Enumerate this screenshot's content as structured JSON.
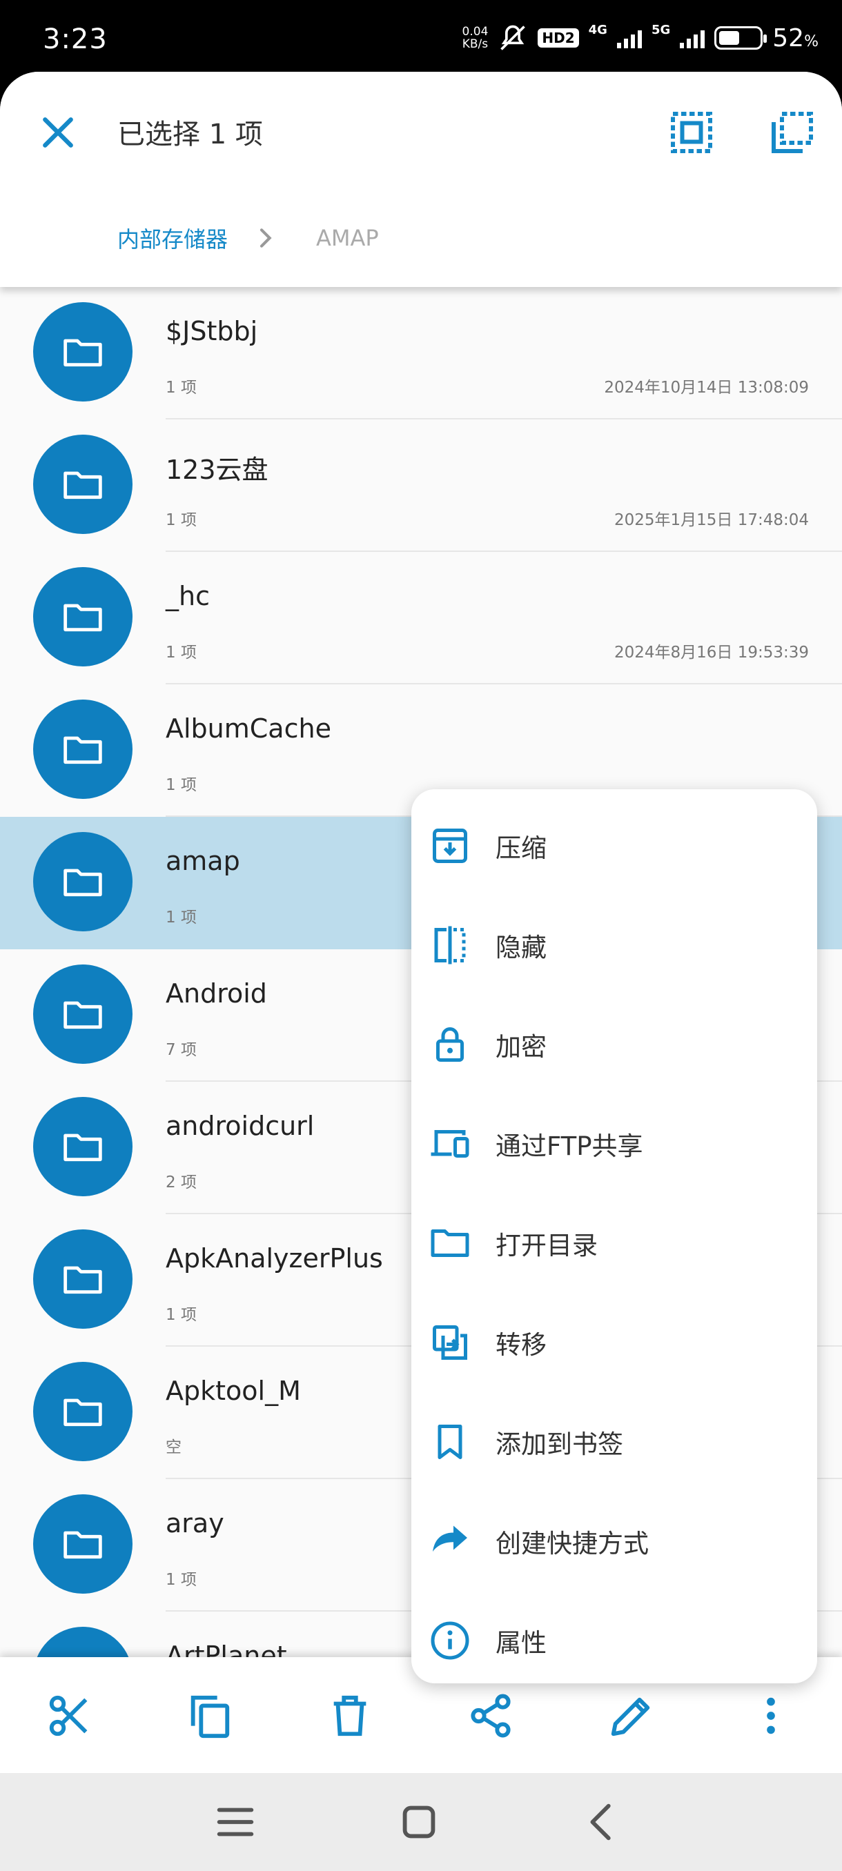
{
  "status_bar": {
    "time": "3:23",
    "speed_value": "0.04",
    "speed_unit": "KB/s",
    "hd_badge": "HD2",
    "network_1": "4G",
    "network_2": "5G",
    "battery_percent": "52",
    "battery_unit": "%",
    "battery_level": 0.52
  },
  "header": {
    "title": "已选择 1 项",
    "breadcrumb": [
      "内部存储器",
      "AMAP"
    ]
  },
  "files": [
    {
      "name": "$JStbbj",
      "count": "1 项",
      "date": "2024年10月14日 13:08:09",
      "selected": false
    },
    {
      "name": "123云盘",
      "count": "1 项",
      "date": "2025年1月15日 17:48:04",
      "selected": false
    },
    {
      "name": "_hc",
      "count": "1 项",
      "date": "2024年8月16日 19:53:39",
      "selected": false
    },
    {
      "name": "AlbumCache",
      "count": "1 项",
      "date": "",
      "selected": false
    },
    {
      "name": "amap",
      "count": "1 项",
      "date": "",
      "selected": true
    },
    {
      "name": "Android",
      "count": "7 项",
      "date": "",
      "selected": false
    },
    {
      "name": "androidcurl",
      "count": "2 项",
      "date": "",
      "selected": false
    },
    {
      "name": "ApkAnalyzerPlus",
      "count": "1 项",
      "date": "",
      "selected": false
    },
    {
      "name": "Apktool_M",
      "count": "空",
      "date": "",
      "selected": false
    },
    {
      "name": "aray",
      "count": "1 项",
      "date": "",
      "selected": false
    },
    {
      "name": "ArtPlanet",
      "count": "",
      "date": "",
      "selected": false
    }
  ],
  "context_menu": [
    {
      "label": "压缩",
      "icon": "archive-icon"
    },
    {
      "label": "隐藏",
      "icon": "hide-icon"
    },
    {
      "label": "加密",
      "icon": "lock-icon"
    },
    {
      "label": "通过FTP共享",
      "icon": "devices-icon"
    },
    {
      "label": "打开目录",
      "icon": "folder-open-icon"
    },
    {
      "label": "转移",
      "icon": "transfer-icon"
    },
    {
      "label": "添加到书签",
      "icon": "bookmark-icon"
    },
    {
      "label": "创建快捷方式",
      "icon": "shortcut-icon"
    },
    {
      "label": "属性",
      "icon": "info-icon"
    }
  ],
  "bottom_actions": [
    "cut-icon",
    "copy-icon",
    "delete-icon",
    "share-icon",
    "rename-icon",
    "more-icon"
  ],
  "colors": {
    "accent": "#1589c8",
    "folder": "#0f7fbf",
    "selected_row": "#bcdcec"
  }
}
